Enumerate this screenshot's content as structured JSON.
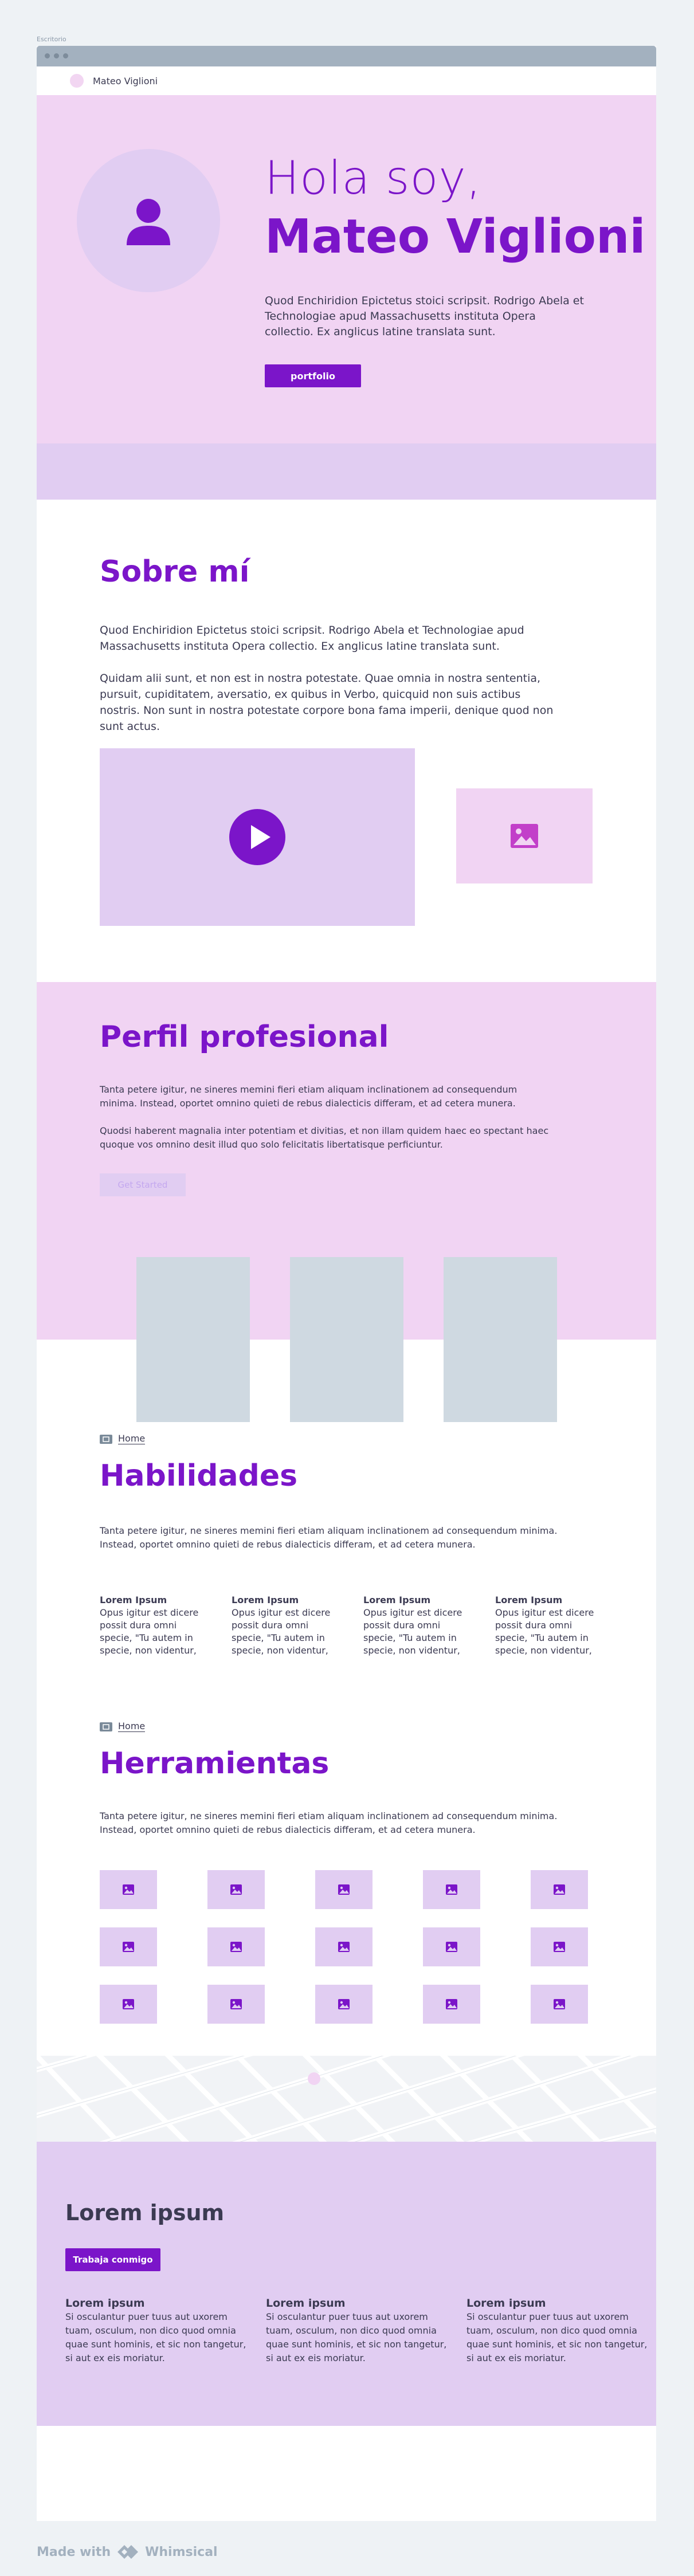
{
  "canvas_label": "Escritorio",
  "nav": {
    "name": "Mateo Viglioni"
  },
  "hero": {
    "greeting": "Hola soy,",
    "name": "Mateo Viglioni",
    "text": "Quod Enchiridion Epictetus stoici scripsit. Rodrigo Abela et Technologiae apud Massachusetts instituta Opera collectio. Ex anglicus latine translata sunt.",
    "button": "portfolio"
  },
  "sobre": {
    "title": "Sobre mí",
    "p1": "Quod Enchiridion Epictetus stoici scripsit. Rodrigo Abela et Technologiae apud Massachusetts instituta Opera collectio. Ex anglicus latine translata sunt.",
    "p2": "Quidam alii sunt, et non est in nostra potestate. Quae omnia in nostra sententia, pursuit, cupiditatem, aversatio, ex quibus in Verbo, quicquid non suis actibus nostris. Non sunt in nostra potestate corpore bona fama imperii, denique quod non sunt actus."
  },
  "perfil": {
    "title": "Perfil profesional",
    "p1": "Tanta petere igitur, ne sineres memini fieri etiam aliquam inclinationem ad consequendum minima. Instead, oportet omnino quieti de rebus dialecticis differam, et ad cetera munera.",
    "p2": "Quodsi haberent magnalia inter potentiam et divitias, et non illam quidem haec eo spectant haec quoque vos omnino desit illud quo solo felicitatis libertatisque perficiuntur.",
    "button": "Get Started"
  },
  "habilidades": {
    "crumb": "Home",
    "title": "Habilidades",
    "text": "Tanta petere igitur, ne sineres memini fieri etiam aliquam inclinationem ad consequendum minima. Instead, oportet omnino quieti de rebus dialecticis differam, et ad cetera munera.",
    "skills": [
      {
        "title": "Lorem Ipsum",
        "text": "Opus igitur est dicere possit dura omni specie, \"Tu autem in specie, non videntur,"
      },
      {
        "title": "Lorem Ipsum",
        "text": "Opus igitur est dicere possit dura omni specie, \"Tu autem in specie, non videntur,"
      },
      {
        "title": "Lorem Ipsum",
        "text": "Opus igitur est dicere possit dura omni specie, \"Tu autem in specie, non videntur,"
      },
      {
        "title": "Lorem Ipsum",
        "text": "Opus igitur est dicere possit dura omni specie, \"Tu autem in specie, non videntur,"
      }
    ]
  },
  "herramientas": {
    "crumb": "Home",
    "title": "Herramientas",
    "text": "Tanta petere igitur, ne sineres memini fieri etiam aliquam inclinationem ad consequendum minima. Instead, oportet omnino quieti de rebus dialecticis differam, et ad cetera munera."
  },
  "footer": {
    "title": "Lorem ipsum",
    "button": "Trabaja conmigo",
    "cols": [
      {
        "title": "Lorem ipsum",
        "text": "Si osculantur puer tuus aut uxorem tuam, osculum, non dico quod omnia quae sunt hominis, et sic non tangetur, si aut ex eis moriatur."
      },
      {
        "title": "Lorem ipsum",
        "text": "Si osculantur puer tuus aut uxorem tuam, osculum, non dico quod omnia quae sunt hominis, et sic non tangetur, si aut ex eis moriatur."
      },
      {
        "title": "Lorem ipsum",
        "text": "Si osculantur puer tuus aut uxorem tuam, osculum, non dico quod omnia quae sunt hominis, et sic non tangetur, si aut ex eis moriatur."
      }
    ]
  },
  "made_with": {
    "prefix": "Made with",
    "brand": "Whimsical"
  },
  "colors": {
    "accent": "#7b15c9",
    "pink": "#f1d4f3",
    "lavender": "#e1cdf2",
    "grey": "#cfd9e1"
  }
}
